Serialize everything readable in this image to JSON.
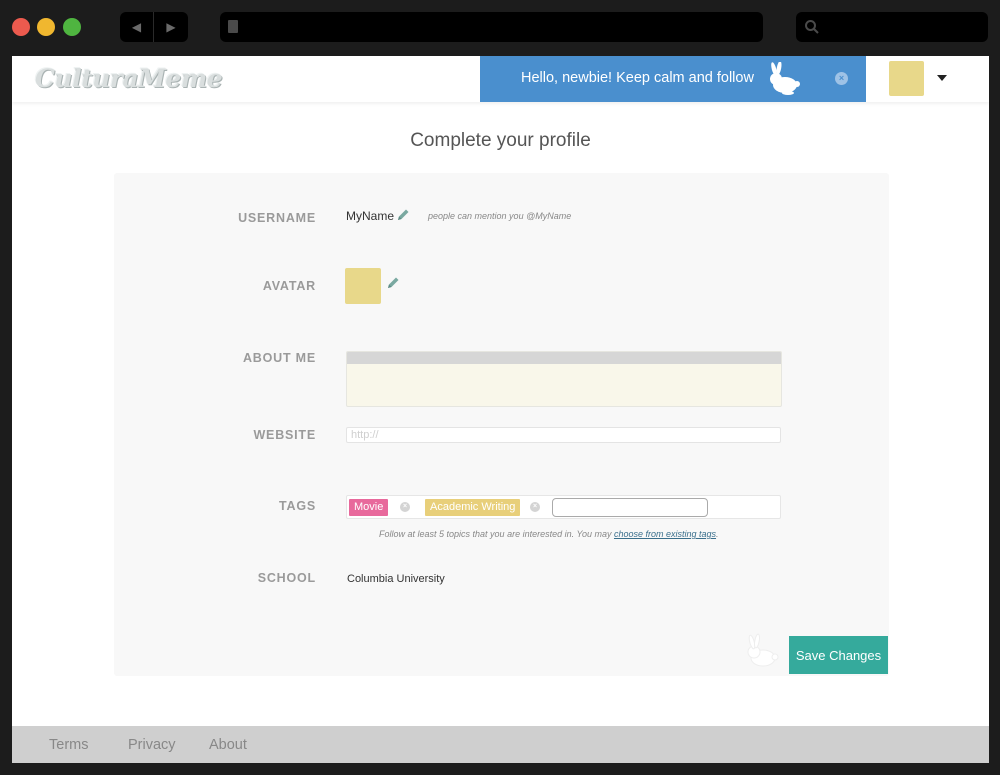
{
  "header": {
    "logo": "CulturaMeme",
    "banner_text": "Hello, newbie!  Keep calm and follow",
    "banner_close": "×"
  },
  "page": {
    "title": "Complete your profile"
  },
  "form": {
    "username": {
      "label": "USERNAME",
      "value": "MyName",
      "hint": "people can mention you @MyName"
    },
    "avatar": {
      "label": "AVATAR"
    },
    "about_me": {
      "label": "ABOUT ME",
      "value": ""
    },
    "website": {
      "label": "WEBSITE",
      "value": "",
      "placeholder": "http://"
    },
    "tags": {
      "label": "TAGS",
      "items": [
        {
          "label": "Movie",
          "color": "#e8699c"
        },
        {
          "label": "Academic Writing",
          "color": "#e8cf7a"
        }
      ],
      "remove_glyph": "×",
      "hint_text": "Follow at least 5 topics that you are interested in.  You may ",
      "hint_link": "choose from existing tags",
      "hint_end": "."
    },
    "school": {
      "label": "SCHOOL",
      "value": "Columbia University"
    },
    "save_label": "Save Changes"
  },
  "footer": {
    "links": [
      "Terms",
      "Privacy",
      "About"
    ]
  },
  "colors": {
    "banner": "#4a8fce",
    "save_button": "#35aa9c",
    "avatar": "#e8d88a"
  },
  "icons": {
    "back": "◀",
    "forward": "▶"
  }
}
